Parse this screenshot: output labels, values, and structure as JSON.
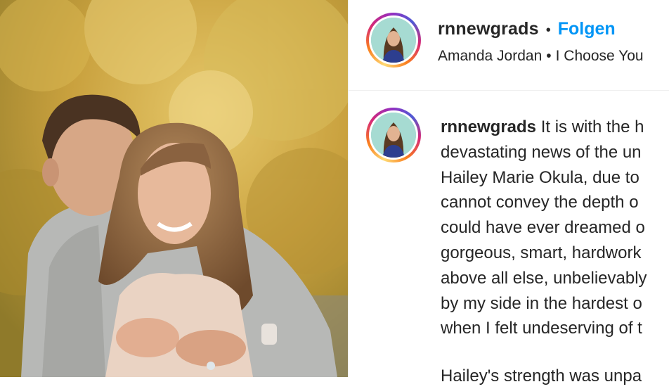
{
  "post": {
    "photo_alt": "engaged couple embracing among yellow foliage"
  },
  "header": {
    "username": "rnnewgrads",
    "separator": "•",
    "follow_label": "Folgen",
    "author_name": "Amanda Jordan",
    "audio_separator": "•",
    "audio_title": "I Choose You"
  },
  "caption": {
    "username": "rnnewgrads",
    "first_line_text": " It is with the h",
    "lines": [
      "devastating news of the un",
      "Hailey Marie Okula, due to",
      "cannot convey the depth o",
      "could have ever dreamed o",
      "gorgeous, smart, hardwork",
      "above all else, unbelievably",
      "by my side in the hardest o",
      "when I felt undeserving of t"
    ],
    "second_paragraph_start": "Hailey's strength was unpa"
  },
  "colors": {
    "follow": "#0095f6",
    "text": "#262626",
    "divider": "#efefef"
  }
}
